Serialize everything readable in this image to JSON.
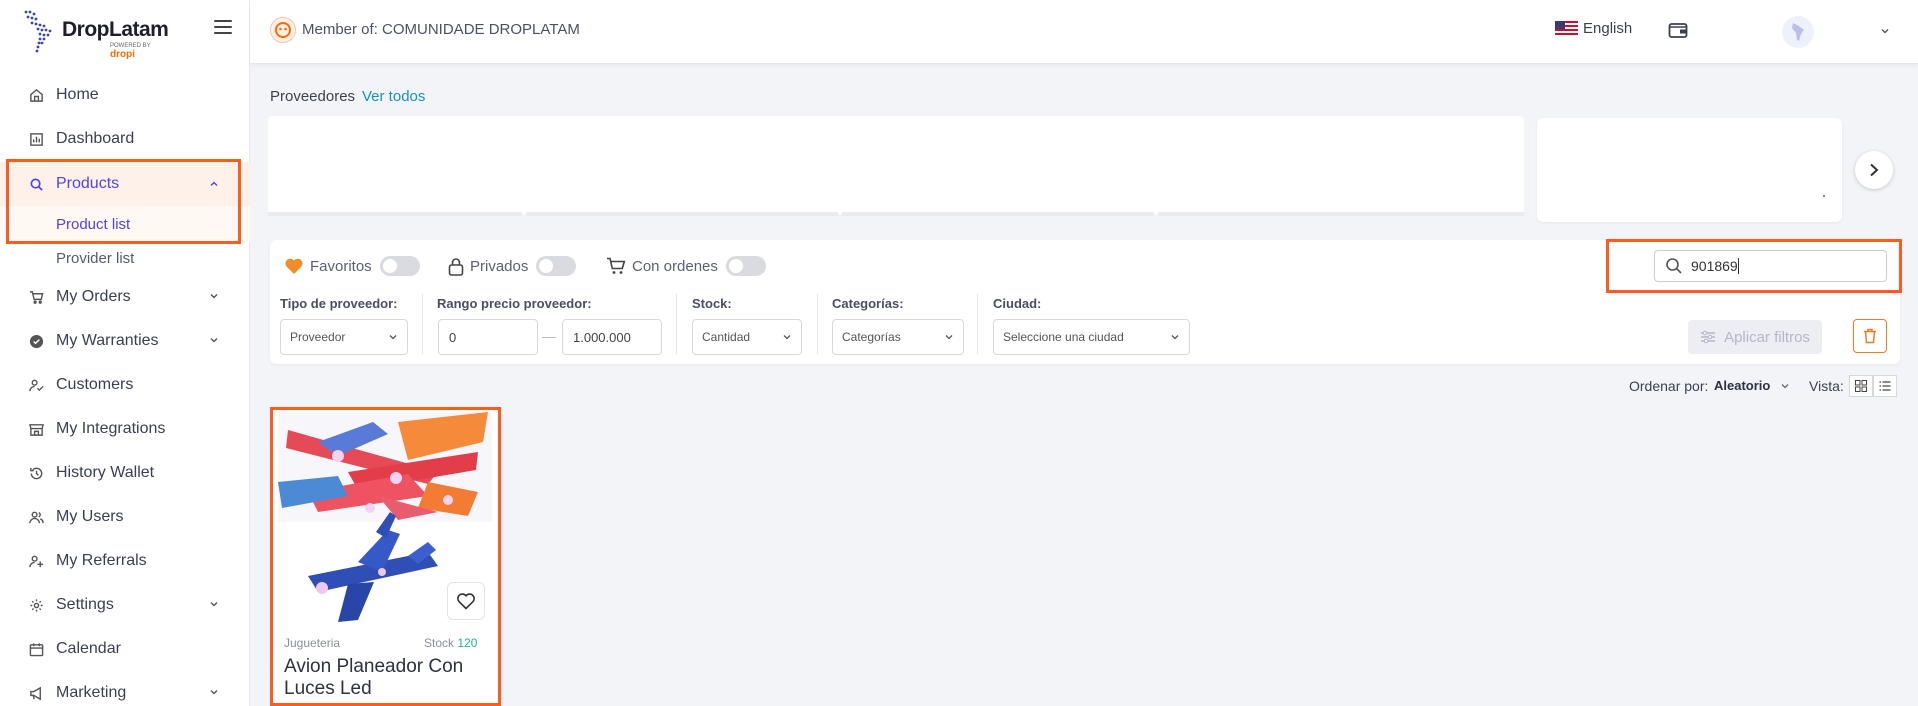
{
  "brand": {
    "name": "DropLatam",
    "powered_prefix": "POWERED BY",
    "powered_brand": "dropi"
  },
  "sidebar": {
    "items": [
      {
        "label": "Home",
        "icon": "home-icon"
      },
      {
        "label": "Dashboard",
        "icon": "chart-icon"
      },
      {
        "label": "Products",
        "icon": "search-icon",
        "active": true
      },
      {
        "label": "My Orders",
        "icon": "cart-icon"
      },
      {
        "label": "My Warranties",
        "icon": "shield-check-icon"
      },
      {
        "label": "Customers",
        "icon": "user-check-icon"
      },
      {
        "label": "My Integrations",
        "icon": "store-icon"
      },
      {
        "label": "History Wallet",
        "icon": "history-icon"
      },
      {
        "label": "My Users",
        "icon": "users-icon"
      },
      {
        "label": "My Referrals",
        "icon": "user-plus-icon"
      },
      {
        "label": "Settings",
        "icon": "gear-icon"
      },
      {
        "label": "Calendar",
        "icon": "calendar-icon"
      },
      {
        "label": "Marketing",
        "icon": "megaphone-icon"
      }
    ],
    "sub_items": [
      {
        "label": "Product list",
        "active": true
      },
      {
        "label": "Provider list"
      }
    ]
  },
  "header": {
    "member_text": "Member of: COMUNIDADE DROPLATAM",
    "language": "English"
  },
  "providers": {
    "title": "Proveedores",
    "link": "Ver todos"
  },
  "filters": {
    "toggles": [
      {
        "label": "Favoritos",
        "on": false
      },
      {
        "label": "Privados",
        "on": false
      },
      {
        "label": "Con ordenes",
        "on": false
      }
    ],
    "search_value": "901869",
    "provider_type_label": "Tipo de proveedor:",
    "provider_type_value": "Proveedor",
    "price_range_label": "Rango precio proveedor:",
    "price_min": "0",
    "price_max": "1.000.000",
    "stock_label": "Stock:",
    "stock_value": "Cantidad",
    "categories_label": "Categorías:",
    "categories_value": "Categorías",
    "city_label": "Ciudad:",
    "city_value": "Seleccione una ciudad",
    "apply_label": "Aplicar filtros"
  },
  "sort": {
    "label": "Ordenar por:",
    "value": "Aleatorio",
    "view_label": "Vista:"
  },
  "products": [
    {
      "category": "Jugueteria",
      "stock_label": "Stock",
      "stock_value": "120",
      "name": "Avion Planeador Con Luces Led"
    }
  ],
  "colors": {
    "accent": "#5045e5",
    "highlight": "#ff5a1f",
    "brand_orange": "#ff6b00",
    "stock_green": "#1fb58c",
    "link_blue": "#1a8fbf"
  }
}
